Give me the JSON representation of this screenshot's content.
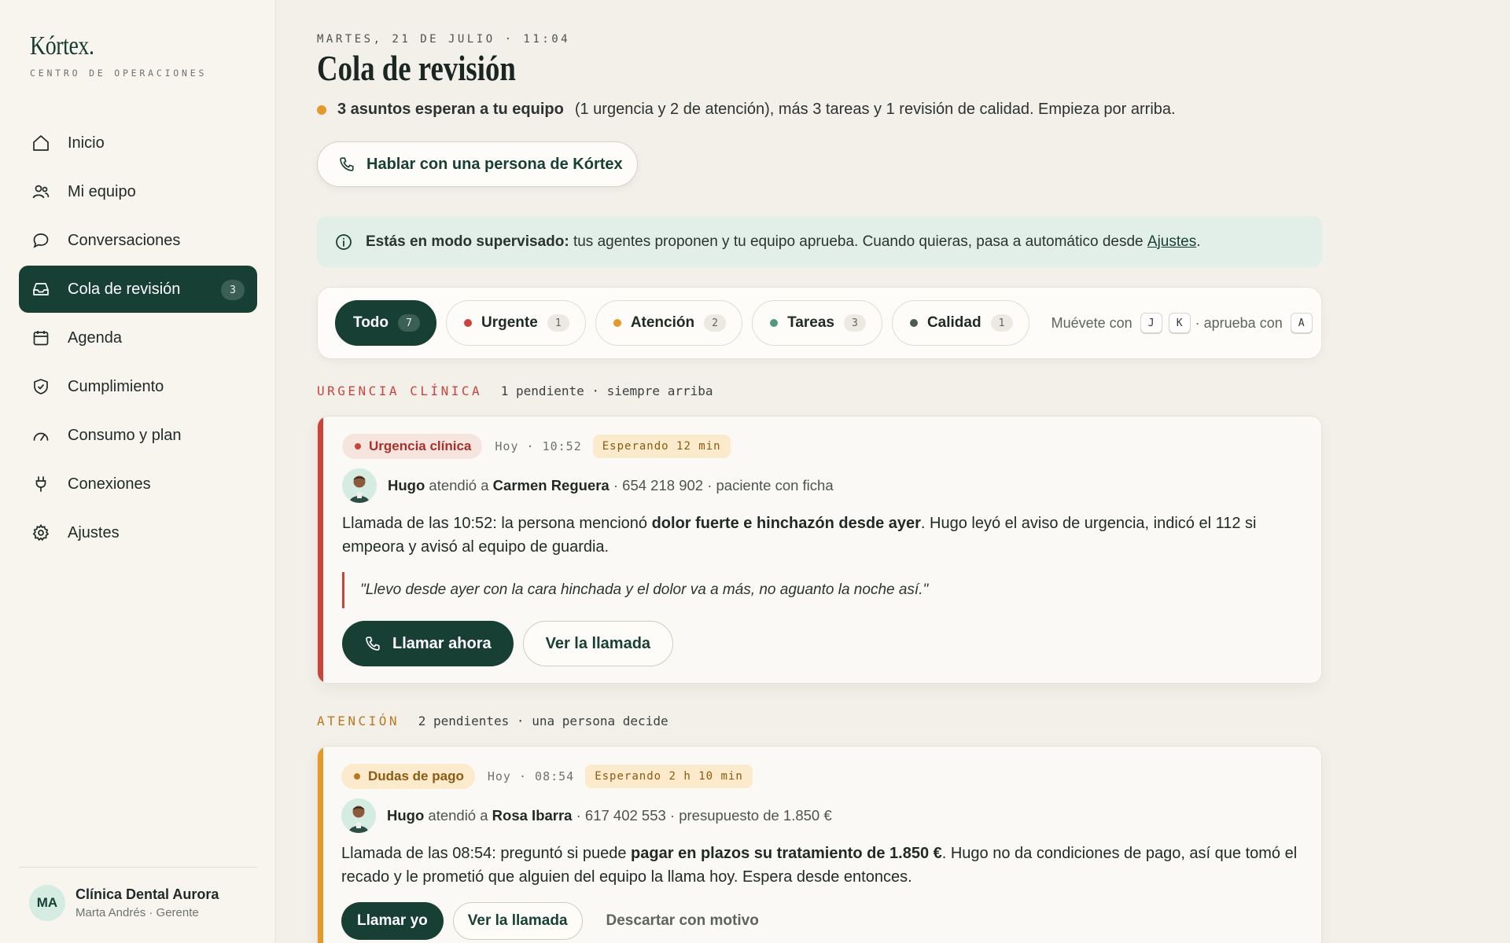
{
  "brand": {
    "name": "Kórtex.",
    "subtitle": "CENTRO DE OPERACIONES"
  },
  "sidebar": {
    "items": [
      {
        "label": "Inicio",
        "icon": "home-icon"
      },
      {
        "label": "Mi equipo",
        "icon": "users-icon"
      },
      {
        "label": "Conversaciones",
        "icon": "chat-icon"
      },
      {
        "label": "Cola de revisión",
        "icon": "inbox-icon",
        "badge": "3",
        "active": true
      },
      {
        "label": "Agenda",
        "icon": "calendar-icon"
      },
      {
        "label": "Cumplimiento",
        "icon": "shield-icon"
      },
      {
        "label": "Consumo y plan",
        "icon": "gauge-icon"
      },
      {
        "label": "Conexiones",
        "icon": "plug-icon"
      },
      {
        "label": "Ajustes",
        "icon": "gear-icon"
      }
    ],
    "footer": {
      "initials": "MA",
      "org": "Clínica Dental Aurora",
      "user": "Marta Andrés · Gerente"
    }
  },
  "header": {
    "date": "MARTES, 21 DE JULIO · 11:04",
    "title": "Cola de revisión",
    "summary_bold": "3 asuntos esperan a tu equipo",
    "summary_rest": "(1 urgencia y 2 de atención), más 3 tareas y 1 revisión de calidad. Empieza por arriba.",
    "talk_button": "Hablar con una persona de Kórtex"
  },
  "notice": {
    "bold": "Estás en modo supervisado:",
    "text": " tus agentes proponen y tu equipo aprueba. Cuando quieras, pasa a automático desde ",
    "link": "Ajustes",
    "end": "."
  },
  "filters": {
    "chips": [
      {
        "label": "Todo",
        "count": "7",
        "active": true
      },
      {
        "label": "Urgente",
        "count": "1",
        "dot": "#c9443a"
      },
      {
        "label": "Atención",
        "count": "2",
        "dot": "#e39a2a"
      },
      {
        "label": "Tareas",
        "count": "3",
        "dot": "#4f9a7e"
      },
      {
        "label": "Calidad",
        "count": "1",
        "dot": "#4c5a56"
      }
    ],
    "hint_move": "Muévete con",
    "key_j": "J",
    "key_k": "K",
    "hint_approve": "· aprueba con",
    "key_a": "A"
  },
  "sections": {
    "urgent": {
      "key": "URGENCIA CLÍNICA",
      "desc": "1 pendiente · siempre arriba"
    },
    "attention": {
      "key": "ATENCIÓN",
      "desc": "2 pendientes · una persona decide"
    }
  },
  "cards": [
    {
      "tag": "Urgencia clínica",
      "time": "Hoy · 10:52",
      "wait": "Esperando 12 min",
      "agent": "Hugo",
      "attended": "atendió a",
      "client": "Carmen Reguera",
      "meta": "· 654 218 902 · paciente con ficha",
      "body_pre": "Llamada de las 10:52: la persona mencionó ",
      "body_bold": "dolor fuerte e hinchazón desde ayer",
      "body_post": ". Hugo leyó el aviso de urgencia, indicó el 112 si empeora y avisó al equipo de guardia.",
      "quote": "\"Llevo desde ayer con la cara hinchada y el dolor va a más, no aguanto la noche así.\"",
      "primary": "Llamar ahora",
      "secondary": "Ver la llamada"
    },
    {
      "tag": "Dudas de pago",
      "time": "Hoy · 08:54",
      "wait": "Esperando 2 h 10 min",
      "agent": "Hugo",
      "attended": "atendió a",
      "client": "Rosa Ibarra",
      "meta": "· 617 402 553 · presupuesto de 1.850 €",
      "body_pre": "Llamada de las 08:54: preguntó si puede ",
      "body_bold": "pagar en plazos su tratamiento de 1.850 €",
      "body_post": ". Hugo no da condiciones de pago, así que tomó el recado y le prometió que alguien del equipo la llama hoy. Espera desde entonces.",
      "primary": "Llamar yo",
      "secondary": "Ver la llamada",
      "tertiary": "Descartar con motivo"
    }
  ],
  "colors": {
    "accent": "#173f34",
    "urgent": "#c9443a",
    "attention": "#e39a2a"
  }
}
